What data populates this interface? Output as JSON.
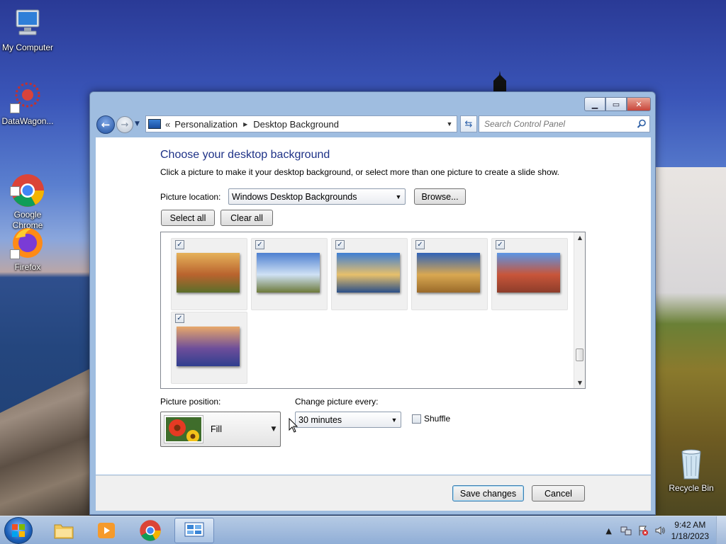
{
  "desktop": {
    "icons": [
      {
        "label": "My Computer"
      },
      {
        "label": "DataWagon..."
      },
      {
        "label": "Google\nChrome"
      },
      {
        "label": "Firefox"
      },
      {
        "label": "Recycle Bin"
      }
    ]
  },
  "window": {
    "address": {
      "overflow_chevron": "«",
      "crumbs": [
        "Personalization",
        "Desktop Background"
      ],
      "separator": "▶"
    },
    "search": {
      "placeholder": "Search Control Panel"
    },
    "title": "Choose your desktop background",
    "instructions": "Click a picture to make it your desktop background, or select more than one picture to create a slide show.",
    "picture_location": {
      "label": "Picture location:",
      "value": "Windows Desktop Backgrounds"
    },
    "browse_label": "Browse...",
    "select_all_label": "Select all",
    "clear_all_label": "Clear all",
    "gallery": [
      {
        "name": "sunset-field",
        "checked": true,
        "colors": [
          "#e6b25a",
          "#b9632e",
          "#5b6e2a"
        ]
      },
      {
        "name": "lighthouse",
        "checked": true,
        "colors": [
          "#4c7fd0",
          "#cfe1f4",
          "#6d7a3a"
        ]
      },
      {
        "name": "rock-lake",
        "checked": true,
        "colors": [
          "#3c7ed4",
          "#e7c06b",
          "#2a4f88"
        ]
      },
      {
        "name": "hay-bale",
        "checked": true,
        "colors": [
          "#2f63b8",
          "#d9a851",
          "#9a6a2a"
        ]
      },
      {
        "name": "delicate-arch",
        "checked": true,
        "colors": [
          "#5a95e6",
          "#c8553a",
          "#8d3d2a"
        ]
      },
      {
        "name": "lupine-sunset",
        "checked": true,
        "colors": [
          "#e8a86a",
          "#6e4e9a",
          "#2f3f8f"
        ]
      }
    ],
    "picture_position": {
      "label": "Picture position:",
      "value": "Fill"
    },
    "change_every": {
      "label": "Change picture every:",
      "value": "30 minutes"
    },
    "shuffle": {
      "label": "Shuffle",
      "checked": false
    },
    "save_label": "Save changes",
    "cancel_label": "Cancel"
  },
  "taskbar": {
    "apps": [
      "file-explorer",
      "media-player",
      "google-chrome",
      "control-panel"
    ],
    "clock": {
      "time": "9:42 AM",
      "date": "1/18/2023"
    }
  },
  "colors": {
    "accent": "#1e3287",
    "window_frame": "#9fbde0",
    "taskbar": "#a9c0de"
  }
}
